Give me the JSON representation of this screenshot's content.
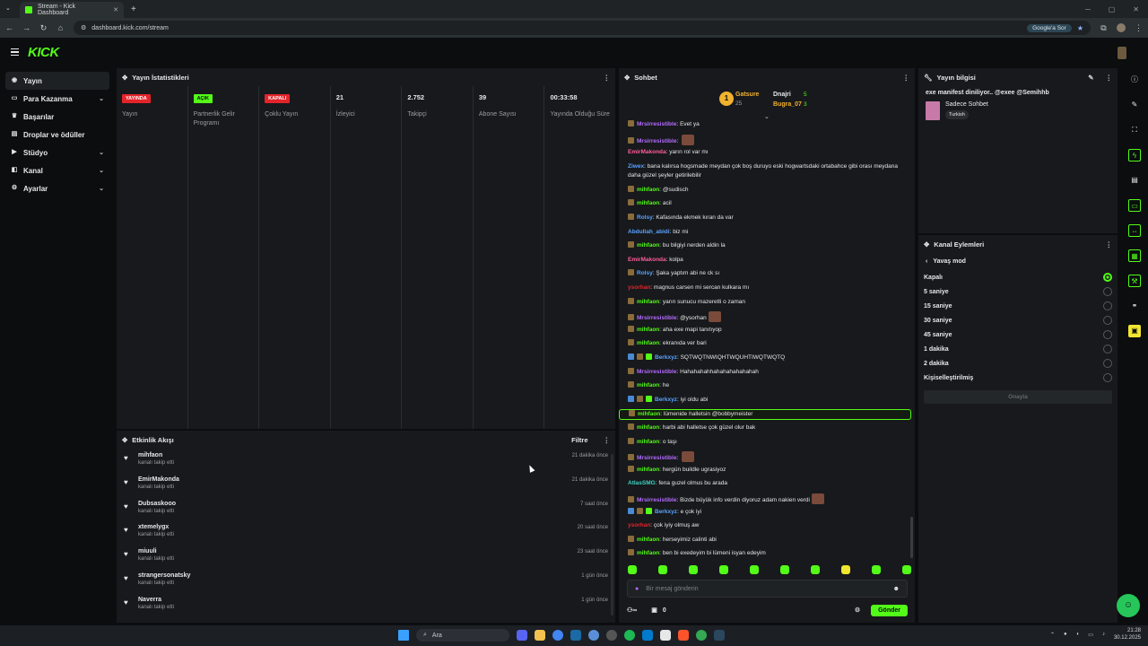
{
  "browser": {
    "tab_title": "Stream - Kick Dashboard",
    "url": "dashboard.kick.com/stream",
    "google_button": "Google'a Sor"
  },
  "brand": {
    "logo": "KICK",
    "accent": "#53fc18"
  },
  "sidebar": {
    "items": [
      {
        "label": "Yayın",
        "icon": "broadcast-icon",
        "active": true
      },
      {
        "label": "Para Kazanma",
        "icon": "money-icon",
        "chevron": true
      },
      {
        "label": "Başarılar",
        "icon": "trophy-icon"
      },
      {
        "label": "Droplar ve ödüller",
        "icon": "gift-icon"
      },
      {
        "label": "Stüdyo",
        "icon": "studio-icon",
        "chevron": true
      },
      {
        "label": "Kanal",
        "icon": "channel-icon",
        "chevron": true
      },
      {
        "label": "Ayarlar",
        "icon": "gear-icon",
        "chevron": true
      }
    ]
  },
  "stats": {
    "title": "Yayın İstatistikleri",
    "items": [
      {
        "badge": "YAYINDA",
        "badge_color": "red",
        "label": "Yayın"
      },
      {
        "badge": "AÇIK",
        "badge_color": "green",
        "label": "Partnerlik Gelir Programı"
      },
      {
        "badge": "KAPALI",
        "badge_color": "red",
        "label": "Çoklu Yayın"
      },
      {
        "value": "21",
        "label": "İzleyici"
      },
      {
        "value": "2.752",
        "label": "Takipçi"
      },
      {
        "value": "39",
        "label": "Abone Sayısı"
      },
      {
        "value": "00:33:58",
        "label": "Yayında Olduğu Süre"
      }
    ]
  },
  "activity": {
    "title": "Etkinlik Akışı",
    "filter_label": "Filtre",
    "rows": [
      {
        "name": "mihfaon",
        "sub": "kanalı takip etti",
        "time": "21 dakika önce"
      },
      {
        "name": "EmirMakonda",
        "sub": "kanalı takip etti",
        "time": "21 dakika önce"
      },
      {
        "name": "Dubsaskooo",
        "sub": "kanalı takip etti",
        "time": "7 saat önce"
      },
      {
        "name": "xtemelygx",
        "sub": "kanalı takip etti",
        "time": "20 saat önce"
      },
      {
        "name": "miuuli",
        "sub": "kanalı takip etti",
        "time": "23 saat önce"
      },
      {
        "name": "strangersonatsky",
        "sub": "kanalı takip etti",
        "time": "1 gün önce"
      },
      {
        "name": "Naverra",
        "sub": "kanalı takip etti",
        "time": "1 gün önce"
      }
    ]
  },
  "chat": {
    "title": "Sohbet",
    "top_gifters": [
      {
        "name": "Gatsure",
        "count": "25"
      },
      {
        "name": "Dnajri",
        "count": "5"
      },
      {
        "name": "Bugra_07",
        "count": "3"
      }
    ],
    "messages": [
      {
        "user": "Mrsirresistible",
        "color": "purple",
        "text": "Evet ya",
        "badge": "brown"
      },
      {
        "user": "Mrsirresistible",
        "color": "purple",
        "text": "",
        "badge": "brown",
        "emote": true
      },
      {
        "user": "EmirMakonda",
        "color": "pink",
        "text": "yarın rol var mı"
      },
      {
        "user": "Ziwex",
        "color": "blue",
        "text": "bana kalırsa hogsmade meydan çok boş duruyo eski hogwartsdaki ortabahce gibi orası meydana daha güzel şeyler getirilebilir",
        "two_line": true
      },
      {
        "user": "mihfaon",
        "color": "green",
        "text": "@sudisch",
        "badge": "brown"
      },
      {
        "user": "mihfaon",
        "color": "green",
        "text": "acil",
        "badge": "brown"
      },
      {
        "user": "Rolsy",
        "color": "blue",
        "text": "Kafasında ekmek kıran da var",
        "badge": "brown"
      },
      {
        "user": "Abdullah_abidi",
        "color": "blue",
        "text": "biz mi"
      },
      {
        "user": "mihfaon",
        "color": "green",
        "text": "bu bilgiyi nerden aldin la",
        "badge": "brown"
      },
      {
        "user": "EmirMakonda",
        "color": "pink",
        "text": "kolpa"
      },
      {
        "user": "Rolsy",
        "color": "blue",
        "text": "Şaka yaptım abi ne ck sı",
        "badge": "brown"
      },
      {
        "user": "ysorhan",
        "color": "red",
        "text": "magnus carsen mi sercan kulkara mı"
      },
      {
        "user": "mihfaon",
        "color": "green",
        "text": "yarın sunucu mazeretli o zaman",
        "badge": "brown"
      },
      {
        "user": "Mrsirresistible",
        "color": "purple",
        "text": "@ysorhan",
        "badge": "brown",
        "emote": true
      },
      {
        "user": "mihfaon",
        "color": "green",
        "text": "aha exe mapi tanıtıyop",
        "badge": "brown"
      },
      {
        "user": "mihfaon",
        "color": "green",
        "text": "ekranıda ver bari",
        "badge": "brown"
      },
      {
        "user": "Berkxyz",
        "color": "blue",
        "text": "SQTWQTNWIQHTWQUHTIWQTWQTQ",
        "badge": "multi"
      },
      {
        "user": "Mrsirresistible",
        "color": "purple",
        "text": "Hahahahahhahahahahahahah",
        "badge": "brown"
      },
      {
        "user": "mihfaon",
        "color": "green",
        "text": "he",
        "badge": "brown"
      },
      {
        "user": "Berkxyz",
        "color": "blue",
        "text": "iyi oldu abi",
        "badge": "multi"
      },
      {
        "user": "mihfaon",
        "color": "green",
        "text": "lümenide halletsin @bobbymeister",
        "badge": "brown",
        "highlight": true
      },
      {
        "user": "mihfaon",
        "color": "green",
        "text": "harbi abi halletse çok güzel olur bak",
        "badge": "brown"
      },
      {
        "user": "mihfaon",
        "color": "green",
        "text": "o taşı",
        "badge": "brown"
      },
      {
        "user": "Mrsirresistible",
        "color": "purple",
        "text": "",
        "badge": "brown",
        "emote": true
      },
      {
        "user": "mihfaon",
        "color": "green",
        "text": "hergün buildle ugrasiyoz",
        "badge": "brown"
      },
      {
        "user": "AtlasSMG",
        "color": "teal",
        "text": "fena guzel olmus bu arada"
      },
      {
        "user": "Mrsirresistible",
        "color": "purple",
        "text": "Bizde büyük info verdin diyoruz adam nakien verdi",
        "badge": "brown",
        "emote": true
      },
      {
        "user": "Berkxyz",
        "color": "blue",
        "text": "e çok iyi",
        "badge": "multi"
      },
      {
        "user": "ysorhan",
        "color": "red",
        "text": "çok iyiy olmuş aw"
      },
      {
        "user": "mihfaon",
        "color": "green",
        "text": "herseyimiz calinti abi",
        "badge": "brown"
      },
      {
        "user": "mihfaon",
        "color": "green",
        "text": "ben bi exedeyim bi lümeni isyan edeyim",
        "badge": "brown"
      }
    ],
    "input_placeholder": "Bir mesaj gönderin",
    "points": "0",
    "send_label": "Gönder"
  },
  "stream_info": {
    "title": "Yayın bilgisi",
    "stream_title": "exe manifest diniliyor.. @exee @Semihhb",
    "category": "Sadece Sohbet",
    "language": "Turkish"
  },
  "channel_actions": {
    "title": "Kanal Eylemleri",
    "back_label": "Yavaş mod",
    "options": [
      {
        "label": "Kapalı",
        "selected": true
      },
      {
        "label": "5 saniye"
      },
      {
        "label": "15 saniye"
      },
      {
        "label": "30 saniye"
      },
      {
        "label": "45 saniye"
      },
      {
        "label": "1 dakika"
      },
      {
        "label": "2 dakika"
      },
      {
        "label": "Kişiselleştirilmiş"
      }
    ],
    "apply_label": "Onayla"
  },
  "taskbar": {
    "search": "Ara",
    "time": "21:28",
    "date": "30.12.2025"
  }
}
